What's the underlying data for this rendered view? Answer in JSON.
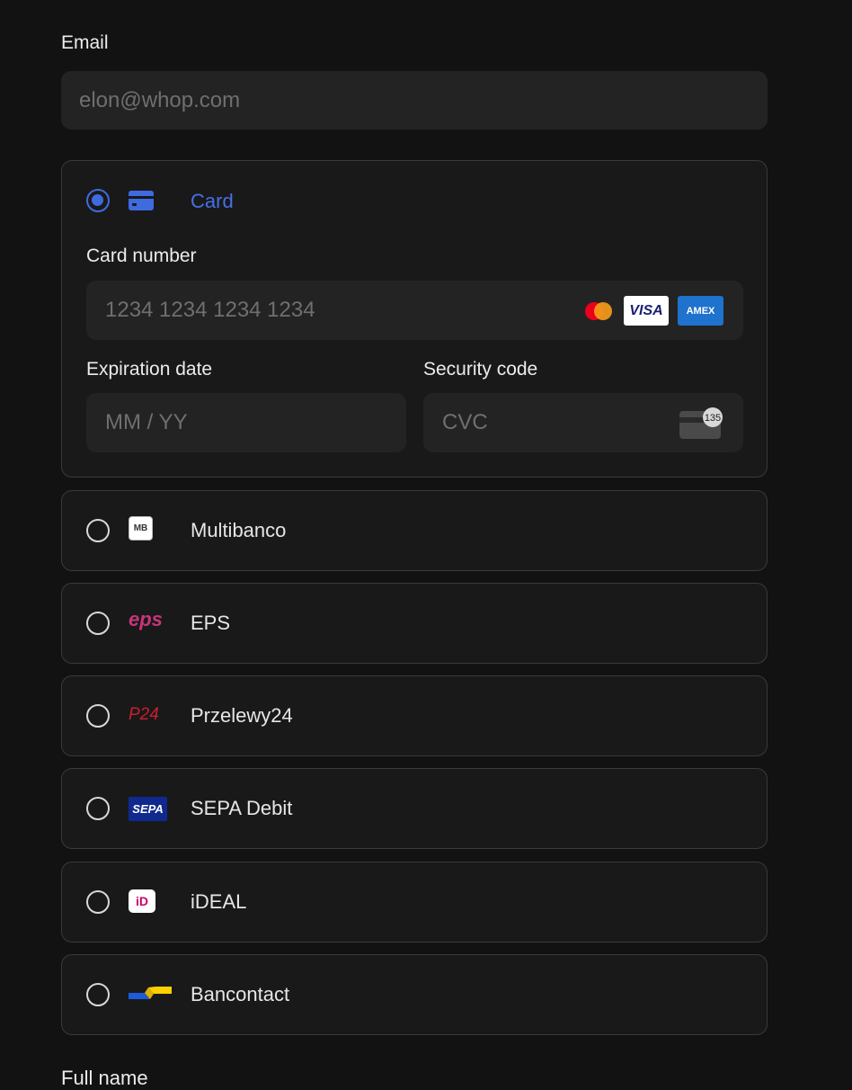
{
  "email": {
    "label": "Email",
    "placeholder": "elon@whop.com"
  },
  "card": {
    "selected": true,
    "title": "Card",
    "number_label": "Card number",
    "number_placeholder": "1234 1234 1234 1234",
    "brands": [
      "mastercard",
      "VISA",
      "AMEX"
    ],
    "expiration_label": "Expiration date",
    "expiration_placeholder": "MM / YY",
    "security_label": "Security code",
    "security_placeholder": "CVC",
    "cvc_hint": "135"
  },
  "methods": [
    {
      "label": "Multibanco",
      "icon": "multibanco-icon",
      "icon_text": "MB"
    },
    {
      "label": "EPS",
      "icon": "eps-icon",
      "icon_text": "eps"
    },
    {
      "label": "Przelewy24",
      "icon": "przelewy24-icon",
      "icon_text": "P24"
    },
    {
      "label": "SEPA Debit",
      "icon": "sepa-icon",
      "icon_text": "SEPA"
    },
    {
      "label": "iDEAL",
      "icon": "ideal-icon",
      "icon_text": "iD"
    },
    {
      "label": "Bancontact",
      "icon": "bancontact-icon",
      "icon_text": ""
    }
  ],
  "next_field_label": "Full name",
  "colors": {
    "accent": "#3f6ae0",
    "background": "#121212",
    "field": "#232323",
    "border": "#3a3a3a"
  }
}
